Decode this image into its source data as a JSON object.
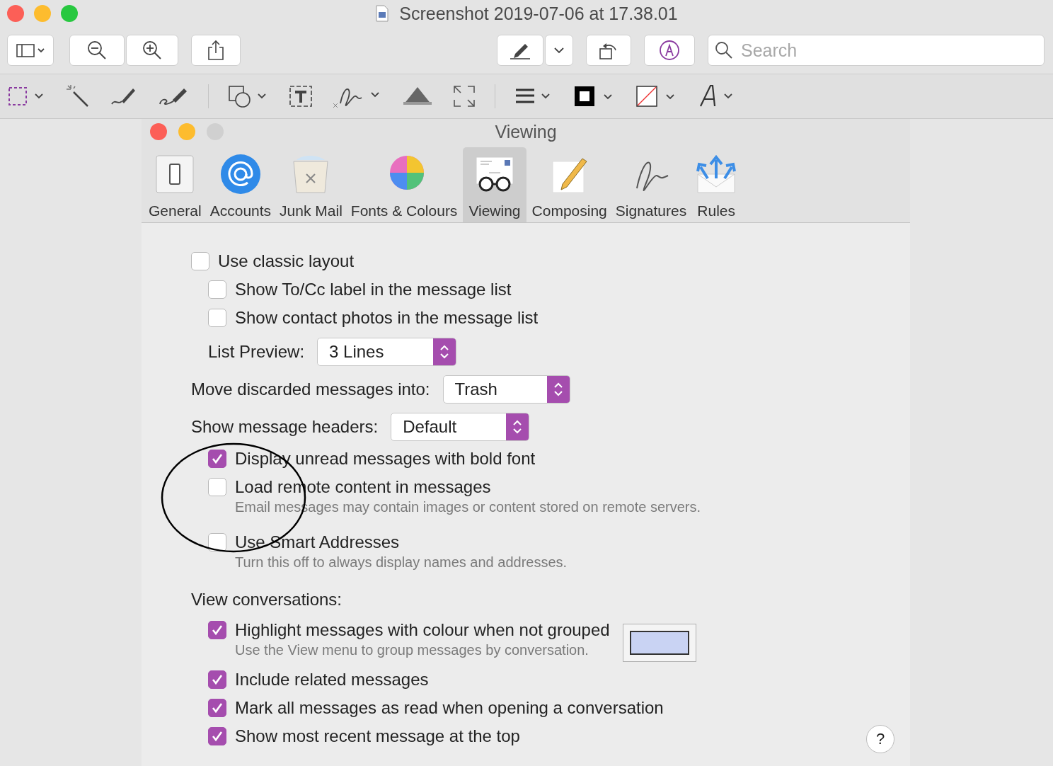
{
  "window": {
    "title": "Screenshot 2019-07-06 at 17.38.01"
  },
  "toolbar": {
    "search": {
      "placeholder": "Search"
    }
  },
  "document": {
    "title": "Viewing",
    "tabs": [
      {
        "label": "General",
        "selected": false
      },
      {
        "label": "Accounts",
        "selected": false
      },
      {
        "label": "Junk Mail",
        "selected": false
      },
      {
        "label": "Fonts & Colours",
        "selected": false
      },
      {
        "label": "Viewing",
        "selected": true
      },
      {
        "label": "Composing",
        "selected": false
      },
      {
        "label": "Signatures",
        "selected": false
      },
      {
        "label": "Rules",
        "selected": false
      }
    ],
    "settings": [
      {
        "kind": "checkbox",
        "label": "Use classic layout",
        "checked": false,
        "indented": false
      },
      {
        "kind": "checkbox",
        "label": "Show To/Cc label in the message list",
        "checked": false,
        "indented": true
      },
      {
        "kind": "checkbox",
        "label": "Show contact photos in the message list",
        "checked": false,
        "indented": true
      },
      {
        "kind": "popup",
        "label": "List Preview:",
        "value": "3 Lines",
        "indented": true
      },
      {
        "kind": "popup",
        "label": "Move discarded messages into:",
        "value": "Trash",
        "indented": false
      },
      {
        "kind": "popup",
        "label": "Show message headers:",
        "value": "Default",
        "indented": false
      },
      {
        "kind": "checkbox",
        "label": "Display unread messages with bold font",
        "checked": true,
        "indented": true
      },
      {
        "kind": "checkbox",
        "label": "Load remote content in messages",
        "checked": false,
        "indented": true,
        "note": "Email messages may contain images or content stored on remote servers."
      },
      {
        "kind": "checkbox",
        "label": "Use Smart Addresses",
        "checked": false,
        "indented": true,
        "note": "Turn this off to always display names and addresses."
      },
      {
        "kind": "heading",
        "label": "View conversations:",
        "indented": false
      },
      {
        "kind": "checkbox",
        "label": "Highlight messages with colour when not grouped",
        "checked": true,
        "indented": true,
        "note": "Use the View menu to group messages by conversation.",
        "color": "#c9d3f3"
      },
      {
        "kind": "checkbox",
        "label": "Include related messages",
        "checked": true,
        "indented": true
      },
      {
        "kind": "checkbox",
        "label": "Mark all messages as read when opening a conversation",
        "checked": true,
        "indented": true
      },
      {
        "kind": "checkbox",
        "label": "Show most recent message at the top",
        "checked": true,
        "indented": true
      }
    ],
    "help": "?"
  }
}
